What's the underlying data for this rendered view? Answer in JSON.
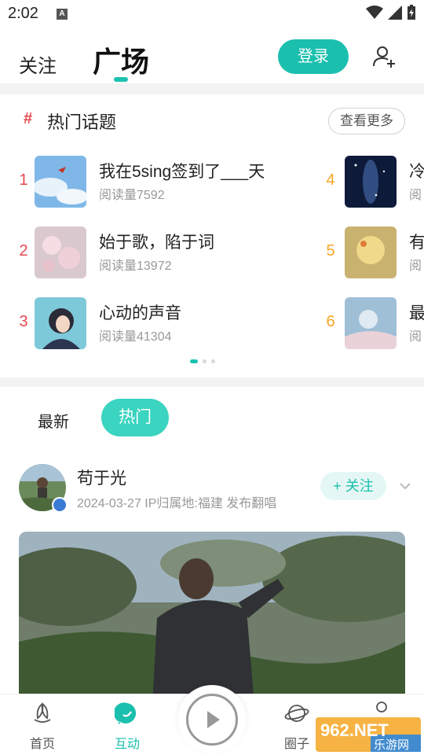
{
  "status_bar": {
    "time": "2:02",
    "notice_letter": "A"
  },
  "header": {
    "tabs": [
      {
        "label": "关注",
        "active": false
      },
      {
        "label": "广场",
        "active": true
      }
    ],
    "login_label": "登录",
    "accent_color": "#1bbfae"
  },
  "hot_topics": {
    "hash": "#",
    "title": "热门话题",
    "more_label": "查看更多",
    "items": [
      {
        "rank": "1",
        "name": "我在5sing签到了___天",
        "reads": "阅读量7592",
        "rank_color": "#e5484d"
      },
      {
        "rank": "2",
        "name": "始于歌，陷于词",
        "reads": "阅读量13972",
        "rank_color": "#e5484d"
      },
      {
        "rank": "3",
        "name": "心动的声音",
        "reads": "阅读量41304",
        "rank_color": "#e5484d"
      },
      {
        "rank": "4",
        "name": "冷",
        "reads": "阅",
        "rank_color": "#f5a623"
      },
      {
        "rank": "5",
        "name": "有",
        "reads": "阅",
        "rank_color": "#f5a623"
      },
      {
        "rank": "6",
        "name": "最",
        "reads": "阅",
        "rank_color": "#f5a623"
      }
    ],
    "pager": {
      "pages": 3,
      "current": 1
    }
  },
  "feed": {
    "tabs": [
      {
        "label": "最新",
        "active": false
      },
      {
        "label": "热门",
        "active": true
      }
    ]
  },
  "post": {
    "user_name": "苟于光",
    "meta": "2024-03-27 IP归属地:福建 发布翻唱",
    "follow_label": "+ 关注"
  },
  "bottom_nav": {
    "items": [
      {
        "label": "首页",
        "icon": "home-leaf-icon",
        "active": false
      },
      {
        "label": "互动",
        "icon": "chat-bubble-icon",
        "active": true
      },
      {
        "label": "",
        "icon": "play-icon",
        "active": false
      },
      {
        "label": "圈子",
        "icon": "planet-icon",
        "active": false
      },
      {
        "label": "",
        "icon": "profile-icon",
        "active": false
      }
    ]
  },
  "watermark": {
    "text_top": "962.NET",
    "text_bottom": "乐游网"
  }
}
